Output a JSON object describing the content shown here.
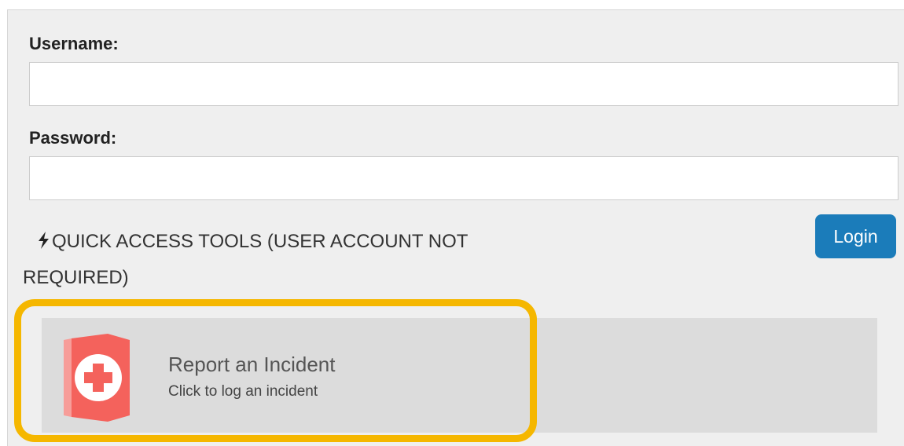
{
  "login_form": {
    "username_label": "Username:",
    "username_value": "",
    "password_label": "Password:",
    "password_value": "",
    "login_button_label": "Login"
  },
  "quick_access": {
    "heading": "QUICK ACCESS TOOLS (USER ACCOUNT NOT REQUIRED)",
    "heading_icon": "bolt-icon",
    "tiles": [
      {
        "title": "Report an Incident",
        "subtitle": "Click to log an incident",
        "icon": "first-aid-icon",
        "highlighted": true
      }
    ]
  },
  "colors": {
    "panel_background": "#efefef",
    "login_button": "#1b7cba",
    "highlight_ring": "#f5b700",
    "tile_background": "#dcdcdc",
    "incident_icon": "#f4625c"
  }
}
